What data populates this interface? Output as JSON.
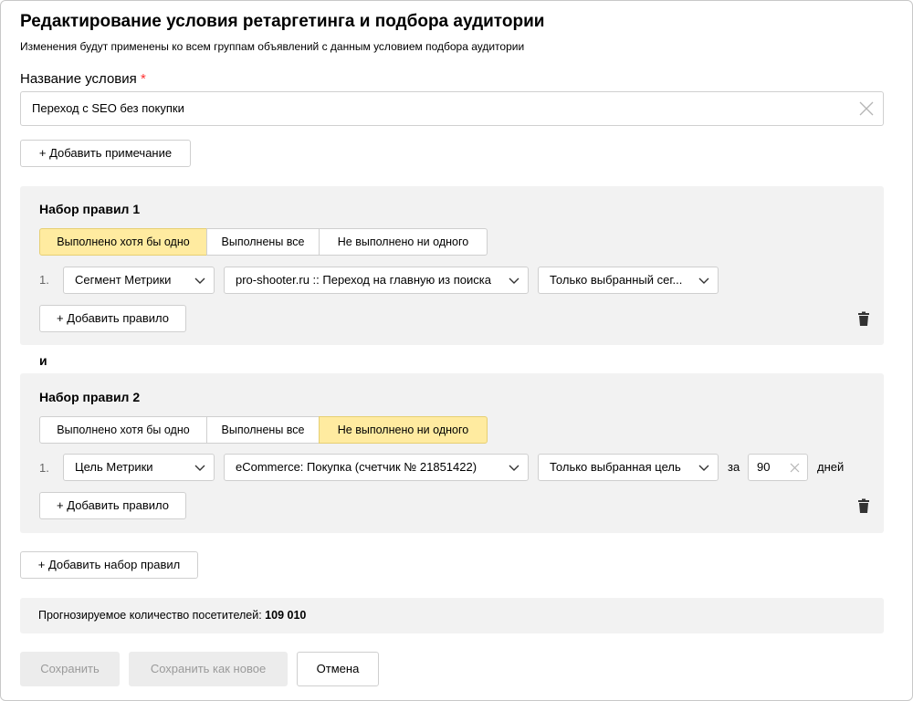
{
  "dialog": {
    "title": "Редактирование условия ретаргетинга и подбора аудитории",
    "subtitle": "Изменения будут применены ко всем группам объявлений с данным условием подбора аудитории",
    "name_label": "Название условия",
    "required_mark": "*",
    "name_value": "Переход с SEO без покупки",
    "add_note_label": "+ Добавить примечание"
  },
  "rule_sets": [
    {
      "title": "Набор правил 1",
      "modes": [
        "Выполнено хотя бы одно",
        "Выполнены все",
        "Не выполнено ни одного"
      ],
      "active_mode": "Выполнено хотя бы одно",
      "rule": {
        "num": "1.",
        "type": "Сегмент Метрики",
        "target": "pro-shooter.ru :: Переход на главную из поиска",
        "scope": "Только выбранный сег..."
      },
      "add_rule_label": "+ Добавить правило"
    },
    {
      "title": "Набор правил 2",
      "modes": [
        "Выполнено хотя бы одно",
        "Выполнены все",
        "Не выполнено ни одного"
      ],
      "active_mode": "Не выполнено ни одного",
      "rule": {
        "num": "1.",
        "type": "Цель Метрики",
        "target": "eCommerce: Покупка (счетчик № 21851422)",
        "scope": "Только выбранная цель",
        "for_label": "за",
        "days_value": "90",
        "days_label": "дней"
      },
      "add_rule_label": "+ Добавить правило"
    }
  ],
  "and_label": "и",
  "add_set_label": "+ Добавить набор правил",
  "forecast": {
    "label": "Прогнозируемое количество посетителей:",
    "value": "109 010"
  },
  "footer": {
    "save": "Сохранить",
    "save_new": "Сохранить как новое",
    "cancel": "Отмена"
  },
  "colors": {
    "active_segment": "#ffeba0",
    "panel_bg": "#f2f2f2",
    "required": "#ff3333"
  }
}
